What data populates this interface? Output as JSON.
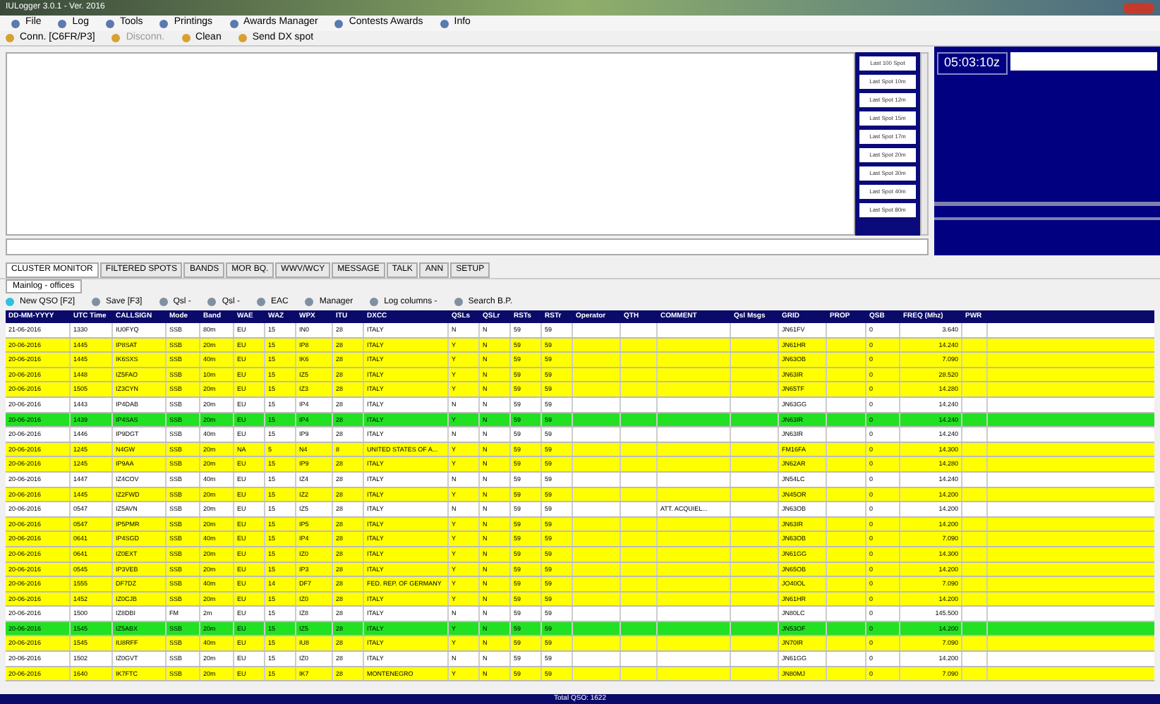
{
  "window": {
    "title": "IULogger 3.0.1 - Ver. 2016"
  },
  "menu": [
    "File",
    "Log",
    "Tools",
    "Printings",
    "Awards Manager",
    "Contests Awards",
    "Info"
  ],
  "toolbar": [
    {
      "label": "Conn. [C6FR/P3]",
      "disabled": false
    },
    {
      "label": "Disconn.",
      "disabled": true
    },
    {
      "label": "Clean",
      "disabled": false
    },
    {
      "label": "Send DX spot",
      "disabled": false
    }
  ],
  "spot_buttons": [
    "Last 100 Spot",
    "Last Spot 10m",
    "Last Spot 12m",
    "Last Spot 15m",
    "Last Spot 17m",
    "Last Spot 20m",
    "Last Spot 30m",
    "Last Spot 40m",
    "Last Spot 80m"
  ],
  "clock": "05:03:10z",
  "tabs": [
    {
      "label": "CLUSTER MONITOR",
      "selected": true
    },
    {
      "label": "FILTERED SPOTS",
      "selected": false
    },
    {
      "label": "BANDS",
      "selected": false
    },
    {
      "label": "MOR BQ.",
      "selected": false
    },
    {
      "label": "WWV/WCY",
      "selected": false
    },
    {
      "label": "MESSAGE",
      "selected": false
    },
    {
      "label": "TALK",
      "selected": false
    },
    {
      "label": "ANN",
      "selected": false
    },
    {
      "label": "SETUP",
      "selected": false
    }
  ],
  "log_tab": "Mainlog - offices",
  "log_toolbar": [
    "New QSO [F2]",
    "Save [F3]",
    "Qsl - ",
    "Qsl - ",
    "EAC",
    "Manager",
    "Log columns -",
    "Search B.P."
  ],
  "table": {
    "columns": [
      "DD-MM-YYYY",
      "UTC Time",
      "CALLSIGN",
      "Mode",
      "Band",
      "WAE",
      "WAZ",
      "WPX",
      "ITU",
      "DXCC",
      "QSLs",
      "QSLr",
      "RSTs",
      "RSTr",
      "Operator",
      "QTH",
      "COMMENT",
      "Qsl Msgs",
      "GRID",
      "PROP",
      "QSB",
      "FREQ (Mhz)",
      "PWR"
    ],
    "rows": [
      {
        "kind": "plain",
        "cells": [
          "21-06-2016",
          "1330",
          "IU0FYQ",
          "SSB",
          "80m",
          "EU",
          "15",
          "IN0",
          "28",
          "ITALY",
          "N",
          "N",
          "59",
          "59",
          "",
          "",
          "",
          "",
          "JN61FV",
          "",
          "0",
          "3.640",
          ""
        ]
      },
      {
        "kind": "new",
        "cells": [
          "20-06-2016",
          "1445",
          "IP8SAT",
          "SSB",
          "20m",
          "EU",
          "15",
          "IP8",
          "28",
          "ITALY",
          "Y",
          "N",
          "59",
          "59",
          "",
          "",
          "",
          "",
          "JN61HR",
          "",
          "0",
          "14.240",
          ""
        ]
      },
      {
        "kind": "new",
        "cells": [
          "20-06-2016",
          "1445",
          "IK6SXS",
          "SSB",
          "40m",
          "EU",
          "15",
          "IK6",
          "28",
          "ITALY",
          "Y",
          "N",
          "59",
          "59",
          "",
          "",
          "",
          "",
          "JN63OB",
          "",
          "0",
          "7.090",
          ""
        ]
      },
      {
        "kind": "new",
        "cells": [
          "20-06-2016",
          "1448",
          "IZ5FAO",
          "SSB",
          "10m",
          "EU",
          "15",
          "IZ5",
          "28",
          "ITALY",
          "Y",
          "N",
          "59",
          "59",
          "",
          "",
          "",
          "",
          "JN63IR",
          "",
          "0",
          "28.520",
          ""
        ]
      },
      {
        "kind": "new",
        "cells": [
          "20-06-2016",
          "1505",
          "IZ3CYN",
          "SSB",
          "20m",
          "EU",
          "15",
          "IZ3",
          "28",
          "ITALY",
          "Y",
          "N",
          "59",
          "59",
          "",
          "",
          "",
          "",
          "JN65TF",
          "",
          "0",
          "14.280",
          ""
        ]
      },
      {
        "kind": "plain",
        "cells": [
          "20-06-2016",
          "1443",
          "IP4DAB",
          "SSB",
          "20m",
          "EU",
          "15",
          "IP4",
          "28",
          "ITALY",
          "N",
          "N",
          "59",
          "59",
          "",
          "",
          "",
          "",
          "JN63GG",
          "",
          "0",
          "14.240",
          ""
        ]
      },
      {
        "kind": "worked",
        "cells": [
          "20-06-2016",
          "1439",
          "IP4SAS",
          "SSB",
          "20m",
          "EU",
          "15",
          "IP4",
          "28",
          "ITALY",
          "Y",
          "N",
          "59",
          "59",
          "",
          "",
          "",
          "",
          "JN63IR",
          "",
          "0",
          "14.240",
          ""
        ]
      },
      {
        "kind": "plain",
        "cells": [
          "20-06-2016",
          "1446",
          "IP9DGT",
          "SSB",
          "40m",
          "EU",
          "15",
          "IP9",
          "28",
          "ITALY",
          "N",
          "N",
          "59",
          "59",
          "",
          "",
          "",
          "",
          "JN63IR",
          "",
          "0",
          "14.240",
          ""
        ]
      },
      {
        "kind": "new",
        "cells": [
          "20-06-2016",
          "1245",
          "N4GW",
          "SSB",
          "20m",
          "NA",
          "5",
          "N4",
          "8",
          "UNITED STATES OF A...",
          "Y",
          "N",
          "59",
          "59",
          "",
          "",
          "",
          "",
          "FM16FA",
          "",
          "0",
          "14.300",
          ""
        ]
      },
      {
        "kind": "new",
        "cells": [
          "20-06-2016",
          "1245",
          "IP9AA",
          "SSB",
          "20m",
          "EU",
          "15",
          "IP9",
          "28",
          "ITALY",
          "Y",
          "N",
          "59",
          "59",
          "",
          "",
          "",
          "",
          "JN62AR",
          "",
          "0",
          "14.280",
          ""
        ]
      },
      {
        "kind": "plain",
        "cells": [
          "20-06-2016",
          "1447",
          "IZ4COV",
          "SSB",
          "40m",
          "EU",
          "15",
          "IZ4",
          "28",
          "ITALY",
          "N",
          "N",
          "59",
          "59",
          "",
          "",
          "",
          "",
          "JN54LC",
          "",
          "0",
          "14.240",
          ""
        ]
      },
      {
        "kind": "new",
        "cells": [
          "20-06-2016",
          "1445",
          "IZ2FWD",
          "SSB",
          "20m",
          "EU",
          "15",
          "IZ2",
          "28",
          "ITALY",
          "Y",
          "N",
          "59",
          "59",
          "",
          "",
          "",
          "",
          "JN45OR",
          "",
          "0",
          "14.200",
          ""
        ]
      },
      {
        "kind": "plain",
        "cells": [
          "20-06-2016",
          "0547",
          "IZ5AVN",
          "SSB",
          "20m",
          "EU",
          "15",
          "IZ5",
          "28",
          "ITALY",
          "N",
          "N",
          "59",
          "59",
          "",
          "",
          "ATT. ACQUIEL...",
          "",
          "JN63OB",
          "",
          "0",
          "14.200",
          ""
        ]
      },
      {
        "kind": "new",
        "cells": [
          "20-06-2016",
          "0547",
          "IP5PMR",
          "SSB",
          "20m",
          "EU",
          "15",
          "IP5",
          "28",
          "ITALY",
          "Y",
          "N",
          "59",
          "59",
          "",
          "",
          "",
          "",
          "JN63IR",
          "",
          "0",
          "14.200",
          ""
        ]
      },
      {
        "kind": "new",
        "cells": [
          "20-06-2016",
          "0641",
          "IP4SGD",
          "SSB",
          "40m",
          "EU",
          "15",
          "IP4",
          "28",
          "ITALY",
          "Y",
          "N",
          "59",
          "59",
          "",
          "",
          "",
          "",
          "JN63OB",
          "",
          "0",
          "7.090",
          ""
        ]
      },
      {
        "kind": "new",
        "cells": [
          "20-06-2016",
          "0641",
          "IZ0EXT",
          "SSB",
          "20m",
          "EU",
          "15",
          "IZ0",
          "28",
          "ITALY",
          "Y",
          "N",
          "59",
          "59",
          "",
          "",
          "",
          "",
          "JN61GG",
          "",
          "0",
          "14.300",
          ""
        ]
      },
      {
        "kind": "new",
        "cells": [
          "20-06-2016",
          "0545",
          "IP3VEB",
          "SSB",
          "20m",
          "EU",
          "15",
          "IP3",
          "28",
          "ITALY",
          "Y",
          "N",
          "59",
          "59",
          "",
          "",
          "",
          "",
          "JN65OB",
          "",
          "0",
          "14.200",
          ""
        ]
      },
      {
        "kind": "new",
        "cells": [
          "20-06-2016",
          "1555",
          "DF7DZ",
          "SSB",
          "40m",
          "EU",
          "14",
          "DF7",
          "28",
          "FED. REP. OF GERMANY",
          "Y",
          "N",
          "59",
          "59",
          "",
          "",
          "",
          "",
          "JO40OL",
          "",
          "0",
          "7.090",
          ""
        ]
      },
      {
        "kind": "new",
        "cells": [
          "20-06-2016",
          "1452",
          "IZ0CJB",
          "SSB",
          "20m",
          "EU",
          "15",
          "IZ0",
          "28",
          "ITALY",
          "Y",
          "N",
          "59",
          "59",
          "",
          "",
          "",
          "",
          "JN61HR",
          "",
          "0",
          "14.200",
          ""
        ]
      },
      {
        "kind": "plain",
        "cells": [
          "20-06-2016",
          "1500",
          "IZ8DBI",
          "FM",
          "2m",
          "EU",
          "15",
          "IZ8",
          "28",
          "ITALY",
          "N",
          "N",
          "59",
          "59",
          "",
          "",
          "",
          "",
          "JN80LC",
          "",
          "0",
          "145.500",
          ""
        ]
      },
      {
        "kind": "worked",
        "cells": [
          "20-06-2016",
          "1545",
          "IZ5ABX",
          "SSB",
          "20m",
          "EU",
          "15",
          "IZ5",
          "28",
          "ITALY",
          "Y",
          "N",
          "59",
          "59",
          "",
          "",
          "",
          "",
          "JN53OF",
          "",
          "0",
          "14.200",
          ""
        ]
      },
      {
        "kind": "new",
        "cells": [
          "20-06-2016",
          "1545",
          "IU8RFF",
          "SSB",
          "40m",
          "EU",
          "15",
          "IU8",
          "28",
          "ITALY",
          "Y",
          "N",
          "59",
          "59",
          "",
          "",
          "",
          "",
          "JN70IR",
          "",
          "0",
          "7.090",
          ""
        ]
      },
      {
        "kind": "plain",
        "cells": [
          "20-06-2016",
          "1502",
          "IZ0GVT",
          "SSB",
          "20m",
          "EU",
          "15",
          "IZ0",
          "28",
          "ITALY",
          "N",
          "N",
          "59",
          "59",
          "",
          "",
          "",
          "",
          "JN61GG",
          "",
          "0",
          "14.200",
          ""
        ]
      },
      {
        "kind": "new",
        "cells": [
          "20-06-2016",
          "1640",
          "IK7FTC",
          "SSB",
          "20m",
          "EU",
          "15",
          "IK7",
          "28",
          "MONTENEGRO",
          "Y",
          "N",
          "59",
          "59",
          "",
          "",
          "",
          "",
          "JN80MJ",
          "",
          "0",
          "7.090",
          ""
        ]
      }
    ]
  },
  "status": "Total QSO: 1622"
}
